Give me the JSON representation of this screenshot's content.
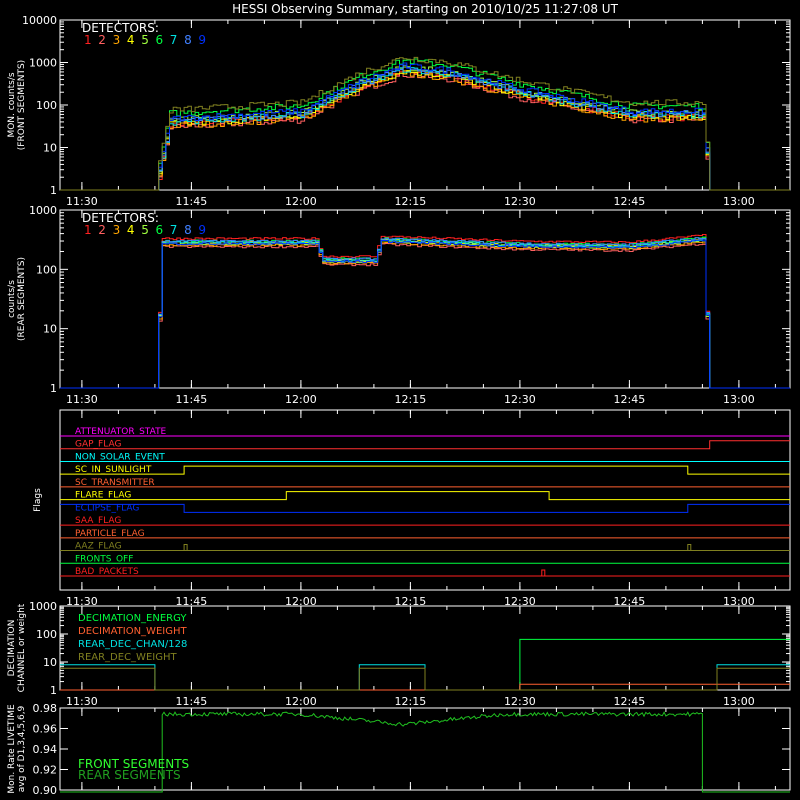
{
  "title": "HESSI Observing Summary, starting on 2010/10/25 11:27:08 UT",
  "time_ticks": [
    "11:30",
    "11:45",
    "12:00",
    "12:15",
    "12:30",
    "12:45",
    "13:00"
  ],
  "detectors": {
    "label": "DETECTORS:",
    "numbers": [
      "1",
      "2",
      "3",
      "4",
      "5",
      "6",
      "7",
      "8",
      "9"
    ],
    "colors": [
      "#ff2020",
      "#ff6060",
      "#ffa500",
      "#ffff00",
      "#a0ff40",
      "#00ff40",
      "#00e0e0",
      "#4080ff",
      "#0030ff"
    ]
  },
  "chart_data": [
    {
      "type": "line",
      "ylabel": "MON. counts/s (FRONT SEGMENTS)",
      "ylabel_lines": [
        "MON. counts/s",
        "(FRONT SEGMENTS)"
      ],
      "yscale": "log",
      "ylim": [
        1,
        10000
      ],
      "yticks": [
        "1",
        "10",
        "100",
        "1000",
        "10000"
      ],
      "xlim": [
        "11:27",
        "13:07"
      ],
      "series_shape": {
        "x": [
          "11:27",
          "11:40",
          "11:42",
          "12:00",
          "12:08",
          "12:14",
          "12:20",
          "12:30",
          "12:45",
          "12:55",
          "12:56",
          "13:07"
        ],
        "y": [
          1,
          1,
          40,
          60,
          300,
          700,
          550,
          200,
          60,
          60,
          1,
          1
        ]
      },
      "series": [
        {
          "name": "1",
          "color": "#ff2020",
          "scale": 0.85
        },
        {
          "name": "2",
          "color": "#ff6060",
          "scale": 0.75
        },
        {
          "name": "3",
          "color": "#ffa500",
          "scale": 0.8
        },
        {
          "name": "4",
          "color": "#ffff00",
          "scale": 0.9
        },
        {
          "name": "5",
          "color": "#a0ff40",
          "scale": 1.1
        },
        {
          "name": "6",
          "color": "#00ff40",
          "scale": 1.6
        },
        {
          "name": "7",
          "color": "#00e0e0",
          "scale": 1.0
        },
        {
          "name": "8",
          "color": "#4080ff",
          "scale": 1.05
        },
        {
          "name": "9",
          "color": "#0030ff",
          "scale": 1.2
        },
        {
          "name": "",
          "color": "#808020",
          "scale": 1.9
        }
      ]
    },
    {
      "type": "line",
      "ylabel": "counts/s (REAR SEGMENTS)",
      "ylabel_lines": [
        "counts/s",
        "(REAR SEGMENTS)"
      ],
      "yscale": "log",
      "ylim": [
        1,
        1000
      ],
      "yticks": [
        "1",
        "10",
        "100",
        "1000"
      ],
      "xlim": [
        "11:27",
        "13:07"
      ],
      "series_shape": {
        "x": [
          "11:27",
          "11:40",
          "11:41",
          "12:02",
          "12:03",
          "12:10",
          "12:11",
          "12:30",
          "12:45",
          "12:55",
          "12:56",
          "13:07"
        ],
        "y": [
          1,
          1,
          300,
          300,
          150,
          150,
          330,
          270,
          260,
          340,
          1,
          1
        ]
      },
      "series": [
        {
          "name": "1",
          "color": "#ff2020",
          "scale": 1.1
        },
        {
          "name": "2",
          "color": "#ff6060",
          "scale": 0.8
        },
        {
          "name": "3",
          "color": "#ffa500",
          "scale": 0.85
        },
        {
          "name": "4",
          "color": "#ffff00",
          "scale": 0.95
        },
        {
          "name": "5",
          "color": "#a0ff40",
          "scale": 0.9
        },
        {
          "name": "6",
          "color": "#00ff40",
          "scale": 1.0
        },
        {
          "name": "7",
          "color": "#00e0e0",
          "scale": 0.95
        },
        {
          "name": "8",
          "color": "#4080ff",
          "scale": 1.0
        },
        {
          "name": "9",
          "color": "#0030ff",
          "scale": 0.9
        }
      ]
    },
    {
      "type": "line",
      "ylabel": "Flags",
      "xlim": [
        "11:27",
        "13:07"
      ],
      "flags": [
        {
          "name": "ATTENUATOR_STATE",
          "color": "#ff00ff",
          "steps": []
        },
        {
          "name": "GAP_FLAG",
          "color": "#ff3030",
          "steps": [
            [
              "12:56",
              1
            ]
          ]
        },
        {
          "name": "NON_SOLAR_EVENT",
          "color": "#00ffff",
          "steps": []
        },
        {
          "name": "SC_IN_SUNLIGHT",
          "color": "#ffff00",
          "steps": [
            [
              "11:44",
              1
            ],
            [
              "12:53",
              0
            ]
          ]
        },
        {
          "name": "SC_TRANSMITTER",
          "color": "#ff6030",
          "steps": []
        },
        {
          "name": "FLARE_FLAG",
          "color": "#ffff00",
          "steps": [
            [
              "11:58",
              1
            ],
            [
              "12:34",
              0
            ]
          ]
        },
        {
          "name": "ECLIPSE_FLAG",
          "color": "#0030ff",
          "steps": [
            [
              "11:44",
              0
            ],
            [
              "12:53",
              1
            ]
          ]
        },
        {
          "name": "SAA_FLAG",
          "color": "#ff2020",
          "steps": []
        },
        {
          "name": "PARTICLE_FLAG",
          "color": "#ff6030",
          "steps": []
        },
        {
          "name": "AAZ_FLAG",
          "color": "#808020",
          "spikes": [
            "11:44",
            "12:53"
          ]
        },
        {
          "name": "FRONTS_OFF",
          "color": "#00ff40",
          "steps": []
        },
        {
          "name": "BAD_PACKETS",
          "color": "#ff2020",
          "spikes": [
            "12:33"
          ]
        }
      ]
    },
    {
      "type": "line",
      "ylabel": "DECIMATION CHANNEL or weight",
      "ylabel_lines": [
        "DECIMATION",
        "CHANNEL or weight"
      ],
      "yscale": "log",
      "ylim": [
        1,
        1000
      ],
      "yticks": [
        "1",
        "10",
        "100",
        "1000"
      ],
      "xlim": [
        "11:27",
        "13:07"
      ],
      "legend": [
        {
          "name": "DECIMATION_ENERGY",
          "color": "#00ff40"
        },
        {
          "name": "DECIMATION_WEIGHT",
          "color": "#ff6030"
        },
        {
          "name": "REAR_DEC_CHAN/128",
          "color": "#00e0e0"
        },
        {
          "name": "REAR_DEC_WEIGHT",
          "color": "#808020"
        }
      ]
    },
    {
      "type": "line",
      "ylabel": "Mon. Rate LIVETIME avg of D1,3,4,5,6,9",
      "ylabel_lines": [
        "Mon. Rate LIVETIME",
        "avg of D1,3,4,5,6,9"
      ],
      "ylim": [
        0.9,
        0.98
      ],
      "yticks": [
        "0.90",
        "0.92",
        "0.94",
        "0.96",
        "0.98"
      ],
      "xlim": [
        "11:27",
        "13:07"
      ],
      "legend": [
        {
          "name": "FRONT SEGMENTS",
          "color": "#30ff30"
        },
        {
          "name": "REAR SEGMENTS",
          "color": "#20a020"
        }
      ]
    }
  ]
}
